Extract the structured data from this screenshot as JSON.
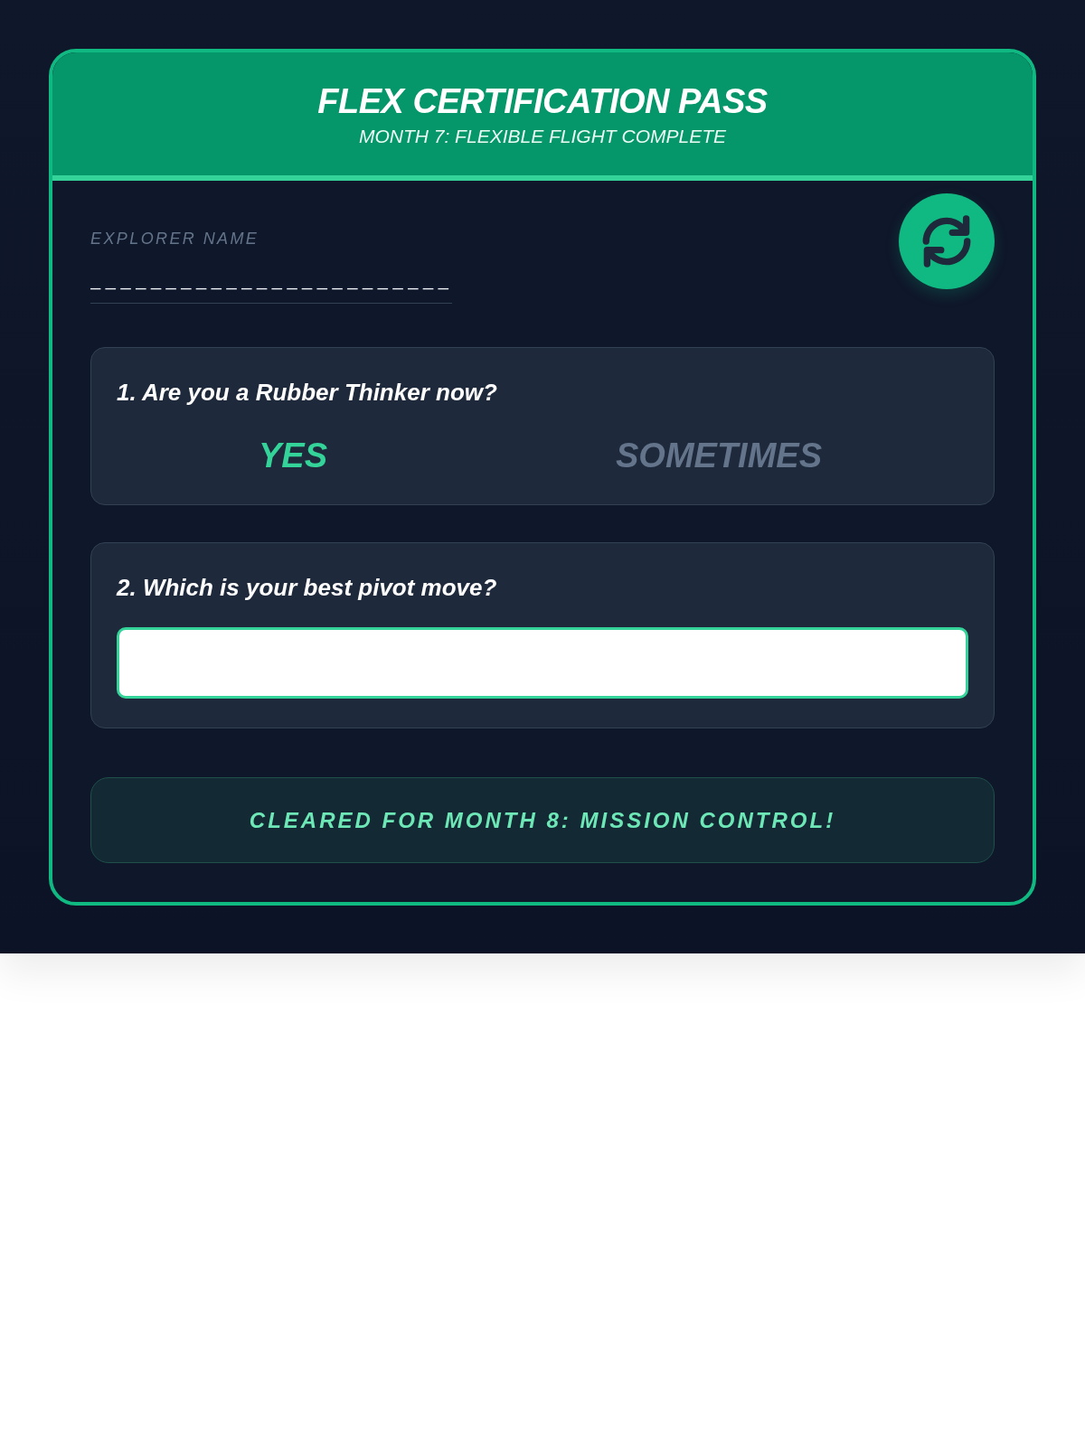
{
  "pass": {
    "title": "FLEX CERTIFICATION PASS",
    "subtitle": "MONTH 7: FLEXIBLE FLIGHT COMPLETE"
  },
  "name_field": {
    "label": "EXPLORER NAME",
    "value": "________________________"
  },
  "questions": [
    {
      "kind": "choice",
      "prompt": "1. Are you a Rubber Thinker now?",
      "options": [
        {
          "label": "YES",
          "selected": true
        },
        {
          "label": "SOMETIMES",
          "selected": false
        }
      ]
    },
    {
      "kind": "text",
      "prompt": "2. Which is your best pivot move?"
    }
  ],
  "banner": "CLEARED FOR MONTH 8: MISSION CONTROL!"
}
